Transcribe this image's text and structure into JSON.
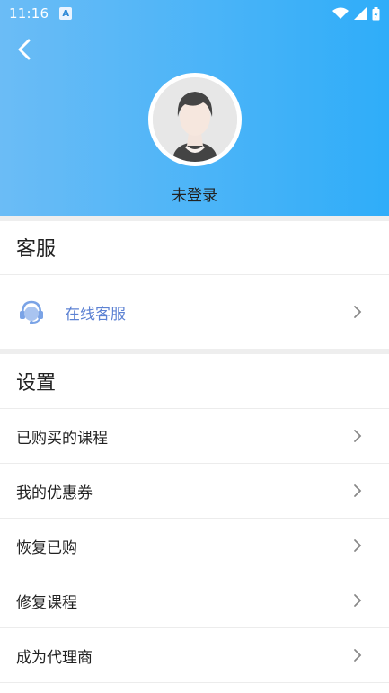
{
  "status_bar": {
    "time": "11:16",
    "notification_icon": "A"
  },
  "header": {
    "login_status": "未登录"
  },
  "sections": {
    "customer_service": {
      "title": "客服",
      "items": [
        {
          "label": "在线客服",
          "icon": "headset-icon"
        }
      ]
    },
    "settings": {
      "title": "设置",
      "items": [
        {
          "label": "已购买的课程"
        },
        {
          "label": "我的优惠券"
        },
        {
          "label": "恢复已购"
        },
        {
          "label": "修复课程"
        },
        {
          "label": "成为代理商"
        }
      ]
    }
  },
  "colors": {
    "header_start": "#6bbcf6",
    "header_end": "#2fadf9",
    "service_text": "#5d82d3",
    "divider": "#eeeeee"
  }
}
